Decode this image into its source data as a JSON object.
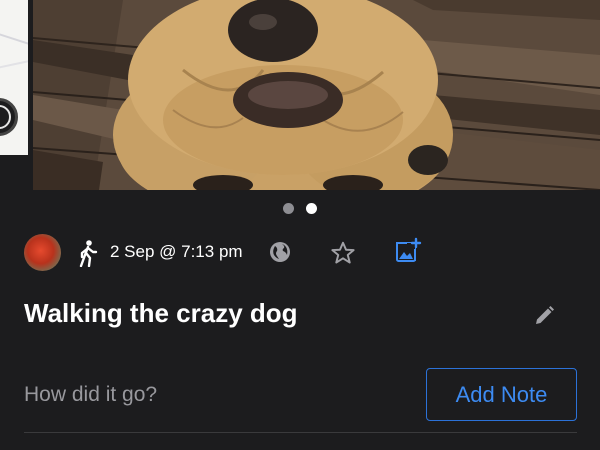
{
  "carousel": {
    "photo_count": 2,
    "active_index": 1
  },
  "activity": {
    "icon": "walking-person-icon",
    "date_time": "2 Sep @ 7:13 pm",
    "visibility_icon": "globe-icon",
    "favorite_icon": "star-outline-icon",
    "add_photo_icon": "add-photo-icon"
  },
  "title": "Walking the crazy dog",
  "note": {
    "placeholder": "How did it go?",
    "value": "",
    "add_button_label": "Add Note"
  },
  "colors": {
    "background": "#1c1c1e",
    "accent": "#3d8bf2",
    "muted_text": "#98989d",
    "divider": "#3a3a3c"
  }
}
